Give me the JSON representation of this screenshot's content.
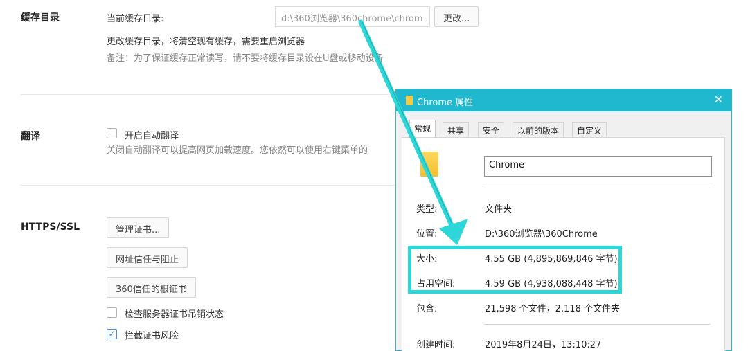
{
  "cache": {
    "section_label": "缓存目录",
    "current_label": "当前缓存目录:",
    "path_value": "d:\\360浏览器\\360chrome\\chrom",
    "change_button": "更改...",
    "note1": "更改缓存目录，将清空现有缓存，需要重启浏览器",
    "note2": "备注：为了保证缓存正常读写，请不要将缓存目录设在U盘或移动设备"
  },
  "translate": {
    "section_label": "翻译",
    "checkbox_label": "开启自动翻译",
    "checked": false,
    "desc": "关闭自动翻译可以提高网页加载速度。您依然可以使用右键菜单的"
  },
  "https": {
    "section_label": "HTTPS/SSL",
    "btn_cert": "管理证书...",
    "btn_trust": "网址信任与阻止",
    "btn_root": "360信任的根证书",
    "check_revoke_label": "检查服务器证书吊销状态",
    "check_revoke": false,
    "check_intercept_label": "拦截证书风险",
    "check_intercept": true
  },
  "dialog": {
    "title": "Chrome 属性",
    "close_glyph": "✕",
    "tabs": [
      "常规",
      "共享",
      "安全",
      "以前的版本",
      "自定义"
    ],
    "active_tab": 0,
    "name_value": "Chrome",
    "props": [
      {
        "label": "类型:",
        "value": "文件夹"
      },
      {
        "label": "位置:",
        "value": "D:\\360浏览器\\360Chrome"
      },
      {
        "label": "大小:",
        "value": "4.55 GB (4,895,869,846 字节)"
      },
      {
        "label": "占用空间:",
        "value": "4.59 GB (4,938,088,448 字节)"
      },
      {
        "label": "包含:",
        "value": "21,598 个文件，2,118 个文件夹"
      },
      {
        "label": "创建时间:",
        "value": "2019年8月24日，13:10:27"
      }
    ]
  },
  "colors": {
    "accent_teal": "#2dd7d7",
    "titlebar": "#1fb8cf",
    "checkbox_blue": "#3c8ef3"
  }
}
